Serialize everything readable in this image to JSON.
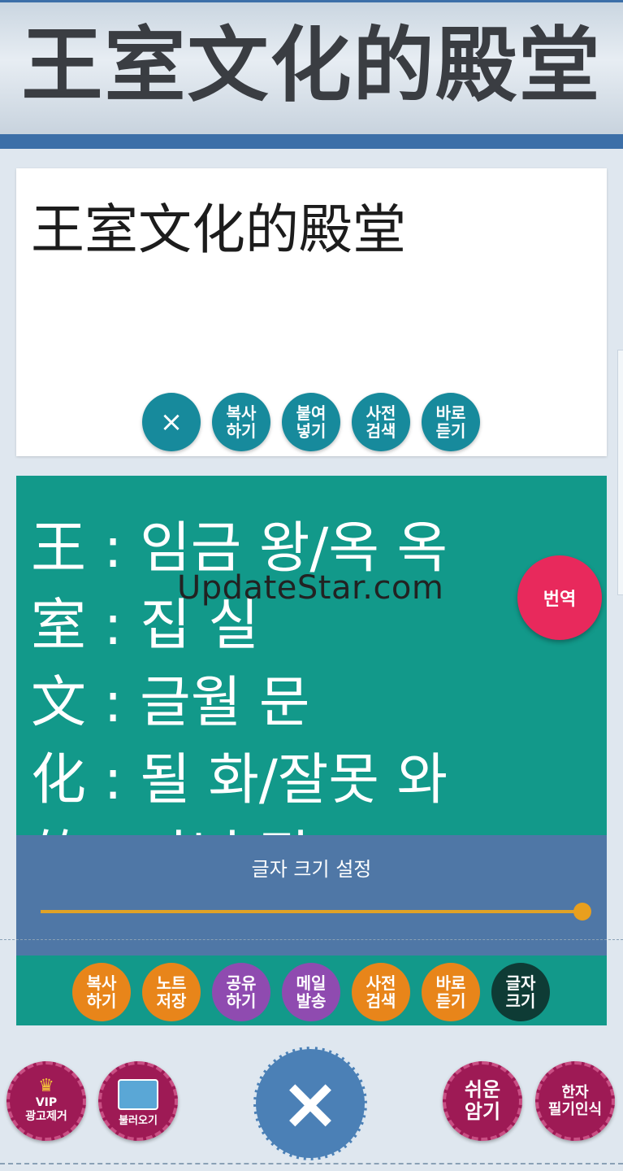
{
  "header": {
    "title": "王室文化的殿堂"
  },
  "input": {
    "text": "王室文化的殿堂",
    "buttons": {
      "clear": "×",
      "copy": "복사\n하기",
      "paste": "붙여\n넣기",
      "dictionary": "사전\n검색",
      "listen": "바로\n듣기"
    }
  },
  "result": {
    "lines": [
      "王 : 임금 왕/옥 옥",
      "室 : 집 실",
      "文 : 글월 문",
      "化 : 될 화/잘못 와",
      "的 : 과녁 적"
    ],
    "translate_button": "번역",
    "watermark": "UpdateStar.com"
  },
  "font_size_panel": {
    "label": "글자 크기 설정",
    "slider_value_fraction": 1.0
  },
  "result_toolbar": {
    "copy": "복사\n하기",
    "note_save": "노트\n저장",
    "share": "공유\n하기",
    "mail": "메일\n발송",
    "dictionary": "사전\n검색",
    "listen": "바로\n듣기",
    "font_size": "글자\n크기"
  },
  "bottom_bar": {
    "vip": "VIP\n광고제거",
    "gallery": "불러오기",
    "close": "×",
    "easy_memorize": "쉬운\n암기",
    "handwriting": "한자\n필기인식"
  },
  "colors": {
    "header_bar": "#3c6fa8",
    "teal_button": "#178a9c",
    "result_bg": "#12998a",
    "translate_pink": "#e8295c",
    "panel_blue": "#4f77a6",
    "slider_orange": "#e0a226",
    "btn_orange": "#e8851a",
    "btn_purple": "#8f4bb0",
    "btn_dark": "#0e3b35",
    "bottom_maroon": "#9e1a55",
    "close_blue": "#4b80b6"
  }
}
